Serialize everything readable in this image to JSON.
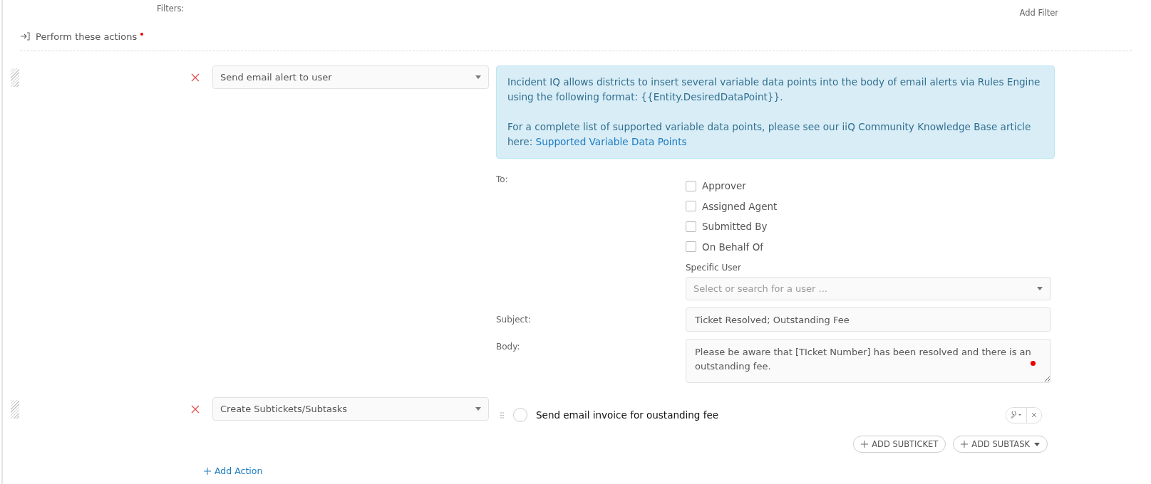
{
  "filters": {
    "label": "Filters:",
    "add_button": "Add Filter"
  },
  "section": {
    "title": "Perform these actions",
    "required": true
  },
  "actions": [
    {
      "kind": "email",
      "action": "Send email alert to user",
      "info": {
        "text_1": "Incident IQ allows districts to insert several variable data points into the body of email alerts via Rules Engine using the following format: {{Entity.DesiredDataPoint}}.",
        "text_2": "For a complete list of supported variable data points, please see our iiQ Community Knowledge Base article here: ",
        "link": "Supported Variable Data Points"
      },
      "to_label": "To:",
      "recipients": [
        {
          "label": "Approver",
          "checked": false
        },
        {
          "label": "Assigned Agent",
          "checked": false
        },
        {
          "label": "Submitted By",
          "checked": false
        },
        {
          "label": "On Behalf Of",
          "checked": false
        }
      ],
      "specific_user": {
        "label": "Specific User",
        "placeholder": "Select or search for a user ..."
      },
      "subject": {
        "label": "Subject:",
        "value": "Ticket Resolved; Outstanding Fee"
      },
      "body": {
        "label": "Body:",
        "value": "Please be aware that [TIcket Number] has been resolved and there is an outstanding fee."
      }
    },
    {
      "kind": "subtasks",
      "action": "Create Subtickets/Subtasks",
      "subtasks": [
        {
          "title": "Send email invoice for oustanding fee",
          "done": false
        }
      ],
      "buttons": [
        "ADD SUBTICKET",
        "ADD SUBTASK"
      ]
    }
  ],
  "add_action": "Add Action"
}
